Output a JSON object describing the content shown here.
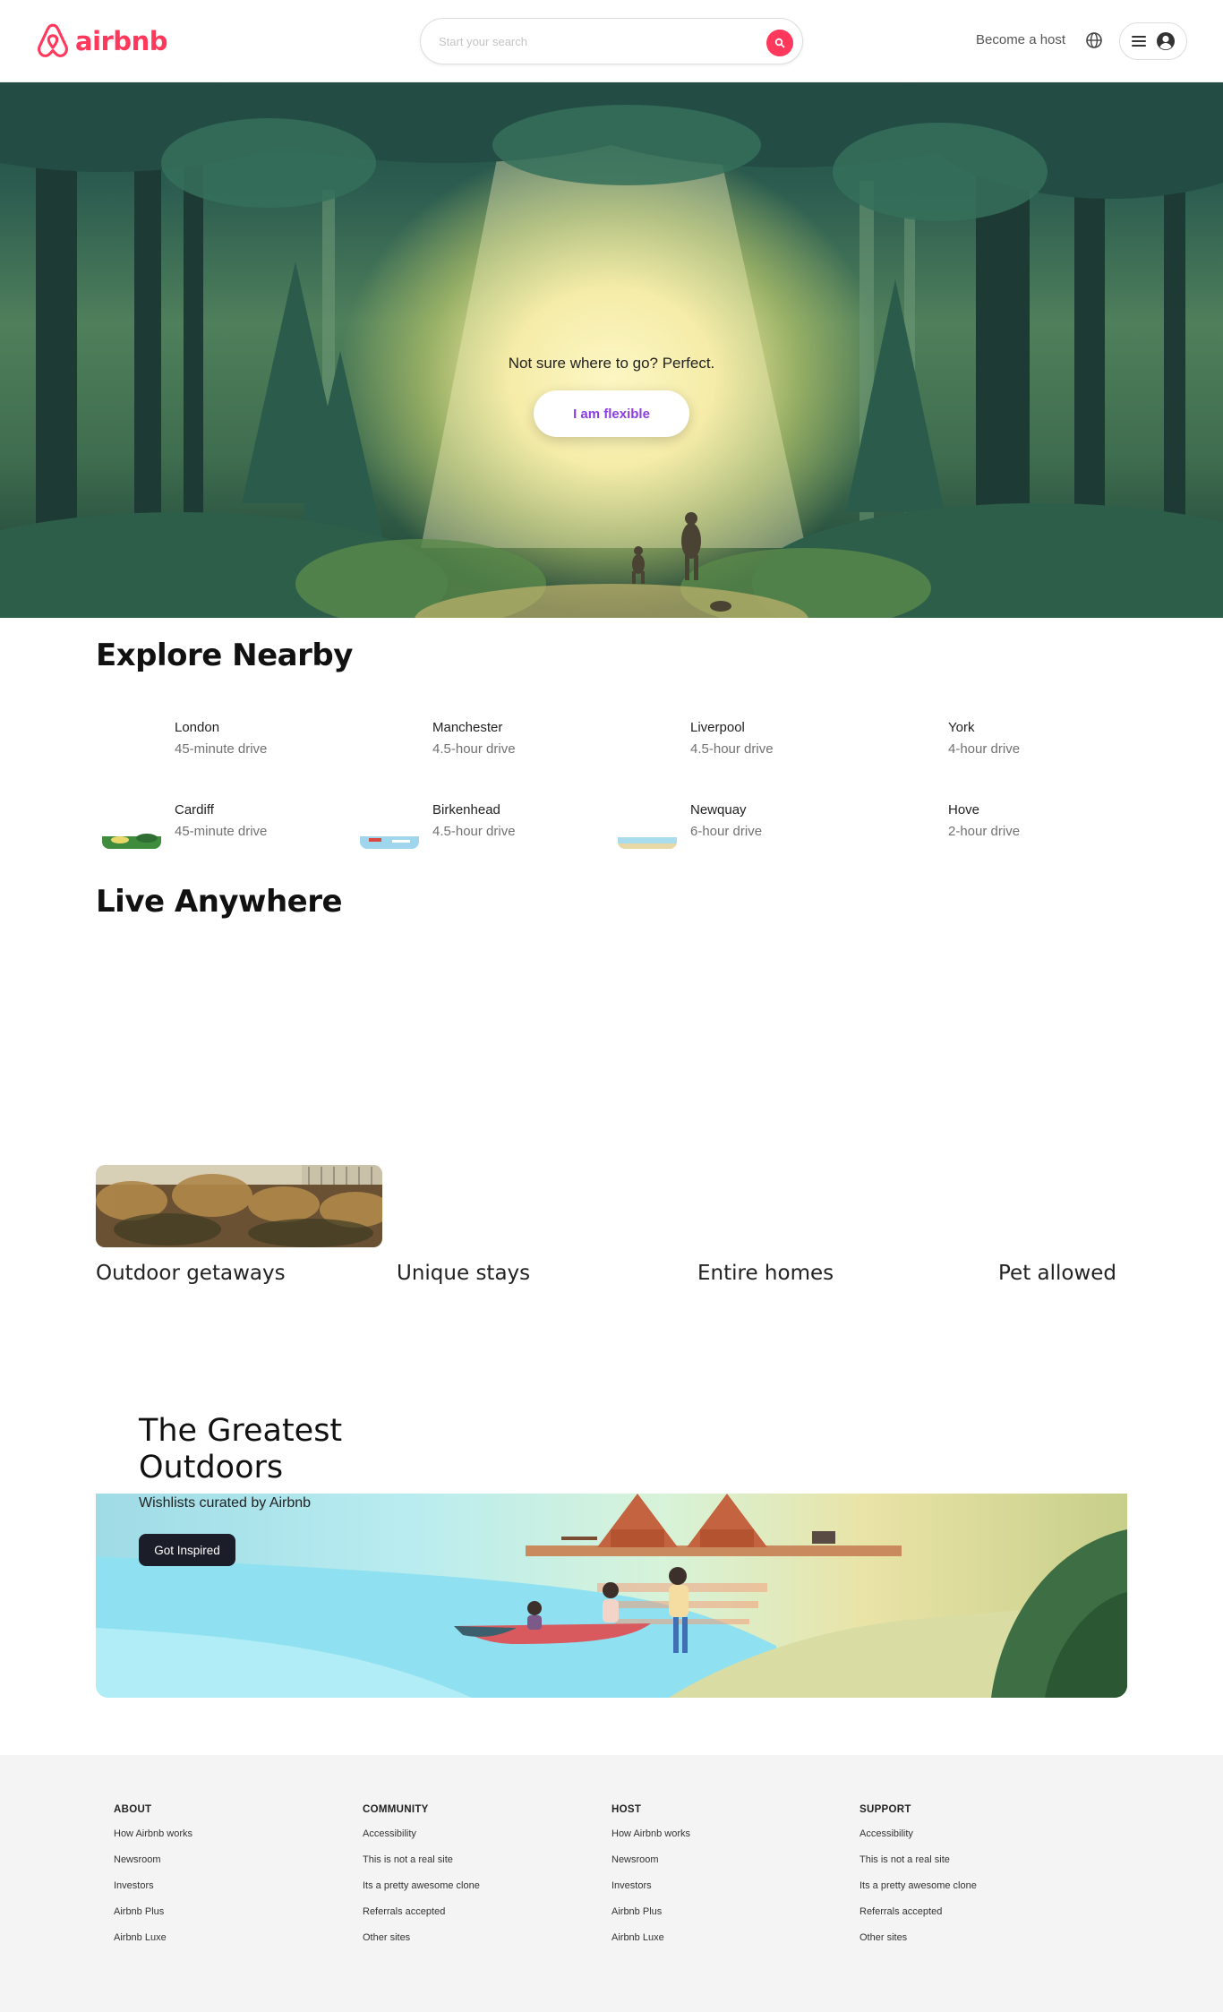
{
  "header": {
    "brand": "airbnb",
    "search_placeholder": "Start your search",
    "become_host": "Become a host",
    "brand_color": "#ff385c"
  },
  "hero": {
    "tagline": "Not sure where to go? Perfect.",
    "cta": "I am flexible"
  },
  "explore": {
    "title": "Explore Nearby",
    "items": [
      {
        "name": "London",
        "distance": "45-minute drive"
      },
      {
        "name": "Manchester",
        "distance": "4.5-hour drive"
      },
      {
        "name": "Liverpool",
        "distance": "4.5-hour drive"
      },
      {
        "name": "York",
        "distance": "4-hour drive"
      },
      {
        "name": "Cardiff",
        "distance": "45-minute drive"
      },
      {
        "name": "Birkenhead",
        "distance": "4.5-hour drive"
      },
      {
        "name": "Newquay",
        "distance": "6-hour drive"
      },
      {
        "name": "Hove",
        "distance": "2-hour drive"
      }
    ]
  },
  "live": {
    "title": "Live Anywhere",
    "cards": [
      {
        "label": "Outdoor getaways"
      },
      {
        "label": "Unique stays"
      },
      {
        "label": "Entire homes"
      },
      {
        "label": "Pet allowed"
      }
    ]
  },
  "outdoors": {
    "title_line1": "The Greatest",
    "title_line2": "Outdoors",
    "subtitle": "Wishlists curated by Airbnb",
    "button": "Got Inspired"
  },
  "footer": {
    "columns": [
      {
        "heading": "ABOUT",
        "links": [
          "How Airbnb works",
          "Newsroom",
          "Investors",
          "Airbnb Plus",
          "Airbnb Luxe"
        ]
      },
      {
        "heading": "COMMUNITY",
        "links": [
          "Accessibility",
          "This is not a real site",
          "Its a pretty awesome clone",
          "Referrals accepted",
          "Other sites"
        ]
      },
      {
        "heading": "HOST",
        "links": [
          "How Airbnb works",
          "Newsroom",
          "Investors",
          "Airbnb Plus",
          "Airbnb Luxe"
        ]
      },
      {
        "heading": "SUPPORT",
        "links": [
          "Accessibility",
          "This is not a real site",
          "Its a pretty awesome clone",
          "Referrals accepted",
          "Other sites"
        ]
      }
    ]
  },
  "icons": {
    "logo": "airbnb-logo-icon",
    "search": "search-icon",
    "globe": "globe-icon",
    "menu": "hamburger-icon",
    "avatar": "user-avatar-icon"
  }
}
